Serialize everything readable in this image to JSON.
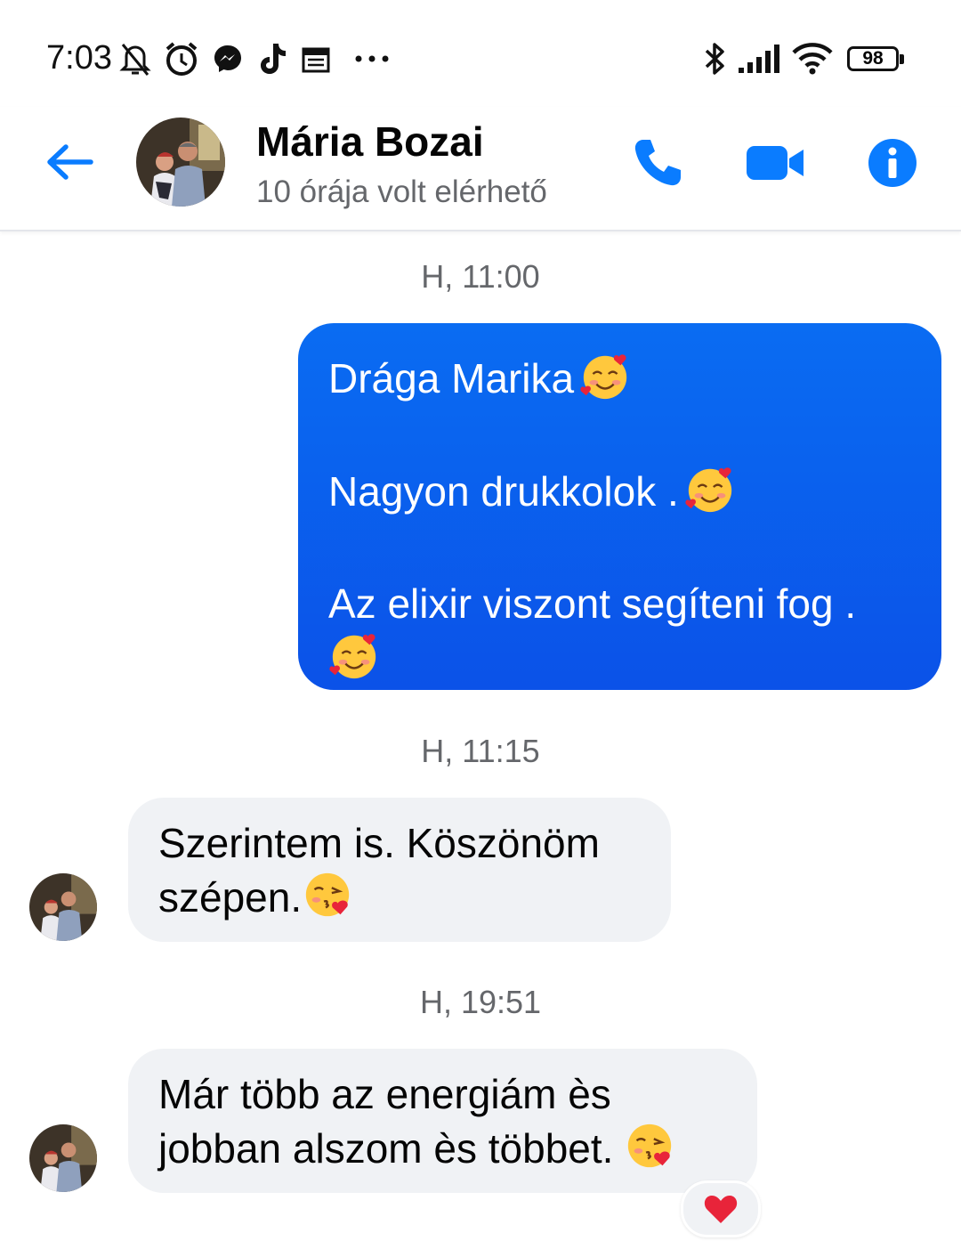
{
  "status_bar": {
    "time": "7:03",
    "battery": "98",
    "icons": [
      "bell-off-icon",
      "alarm-icon",
      "messenger-icon",
      "tiktok-icon",
      "calendar-icon",
      "more-dots-icon",
      "bluetooth-icon",
      "signal-icon",
      "wifi-icon",
      "battery-icon"
    ]
  },
  "header": {
    "name": "Mária Bozai",
    "status": "10 órája volt elérhető",
    "icons": [
      "back-arrow-icon",
      "phone-icon",
      "video-camera-icon",
      "info-icon"
    ],
    "accent_color": "#0a7cff"
  },
  "messages": [
    {
      "timestamp": "H, 11:00",
      "direction": "outgoing",
      "lines": [
        "Drága Marika",
        "Nagyon drukkolok .",
        "Az elixir viszont segíteni fog ."
      ],
      "emoji": "smiling-face-with-hearts"
    },
    {
      "timestamp": "H, 11:15",
      "direction": "incoming",
      "lines": [
        "Szerintem is. Köszönöm",
        "szépen."
      ],
      "emoji": "face-blowing-kiss"
    },
    {
      "timestamp": "H, 19:51",
      "direction": "incoming",
      "lines": [
        "Már több az energiám ès",
        "jobban alszom ès többet."
      ],
      "emoji": "face-blowing-kiss",
      "reaction": "red-heart"
    }
  ],
  "colors": {
    "outgoing_bubble": "#0b5cf0",
    "incoming_bubble": "#f0f2f5",
    "timestamp": "#65676b"
  }
}
